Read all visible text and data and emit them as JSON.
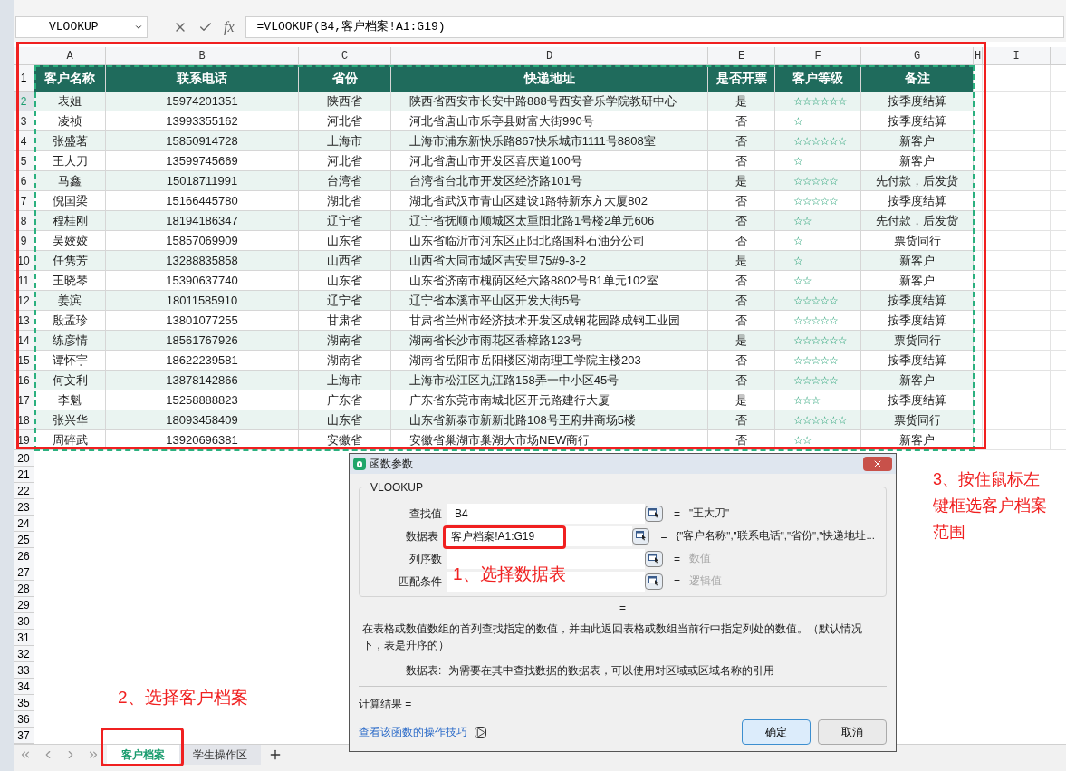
{
  "name_box": {
    "value": "VLOOKUP"
  },
  "formula_bar": {
    "fx": "fx",
    "formula": "=VLOOKUP(B4,客户档案!A1:G19)"
  },
  "column_letters": [
    "A",
    "B",
    "C",
    "D",
    "E",
    "F",
    "G",
    "H",
    "I"
  ],
  "table": {
    "header_row_number": "1",
    "columns": [
      "客户名称",
      "联系电话",
      "省份",
      "快递地址",
      "是否开票",
      "客户等级",
      "备注"
    ],
    "rows": [
      {
        "row_number": "2",
        "selected": true,
        "name": "表姐",
        "phone": "15974201351",
        "province": "陕西省",
        "address": "陕西省西安市长安中路888号西安音乐学院教研中心",
        "invoice": "是",
        "grade": "☆☆☆☆☆☆",
        "note": "按季度结算"
      },
      {
        "row_number": "3",
        "selected": false,
        "name": "凌祯",
        "phone": "13993355162",
        "province": "河北省",
        "address": "河北省唐山市乐亭县财富大街990号",
        "invoice": "否",
        "grade": "☆",
        "note": "按季度结算"
      },
      {
        "row_number": "4",
        "selected": false,
        "name": "张盛茗",
        "phone": "15850914728",
        "province": "上海市",
        "address": "上海市浦东新快乐路867快乐城市1111号8808室",
        "invoice": "否",
        "grade": "☆☆☆☆☆☆",
        "note": "新客户"
      },
      {
        "row_number": "5",
        "selected": false,
        "name": "王大刀",
        "phone": "13599745669",
        "province": "河北省",
        "address": "河北省唐山市开发区喜庆道100号",
        "invoice": "否",
        "grade": "☆",
        "note": "新客户"
      },
      {
        "row_number": "6",
        "selected": false,
        "name": "马鑫",
        "phone": "15018711991",
        "province": "台湾省",
        "address": "台湾省台北市开发区经济路101号",
        "invoice": "是",
        "grade": "☆☆☆☆☆",
        "note": "先付款，后发货"
      },
      {
        "row_number": "7",
        "selected": false,
        "name": "倪国梁",
        "phone": "15166445780",
        "province": "湖北省",
        "address": "湖北省武汉市青山区建设1路特新东方大厦802",
        "invoice": "否",
        "grade": "☆☆☆☆☆",
        "note": "按季度结算"
      },
      {
        "row_number": "8",
        "selected": false,
        "name": "程桂刚",
        "phone": "18194186347",
        "province": "辽宁省",
        "address": "辽宁省抚顺市顺城区太重阳北路1号楼2单元606",
        "invoice": "否",
        "grade": "☆☆",
        "note": "先付款，后发货"
      },
      {
        "row_number": "9",
        "selected": false,
        "name": "吴姣姣",
        "phone": "15857069909",
        "province": "山东省",
        "address": "山东省临沂市河东区正阳北路国科石油分公司",
        "invoice": "否",
        "grade": "☆",
        "note": "票货同行"
      },
      {
        "row_number": "10",
        "selected": false,
        "name": "任隽芳",
        "phone": "13288835858",
        "province": "山西省",
        "address": "山西省大同市城区吉安里75#9-3-2",
        "invoice": "是",
        "grade": "☆",
        "note": "新客户"
      },
      {
        "row_number": "11",
        "selected": false,
        "name": "王晓琴",
        "phone": "15390637740",
        "province": "山东省",
        "address": "山东省济南市槐荫区经六路8802号B1单元102室",
        "invoice": "否",
        "grade": "☆☆",
        "note": "新客户"
      },
      {
        "row_number": "12",
        "selected": false,
        "name": "姜滨",
        "phone": "18011585910",
        "province": "辽宁省",
        "address": "辽宁省本溪市平山区开发大街5号",
        "invoice": "否",
        "grade": "☆☆☆☆☆",
        "note": "按季度结算"
      },
      {
        "row_number": "13",
        "selected": false,
        "name": "殷孟珍",
        "phone": "13801077255",
        "province": "甘肃省",
        "address": "甘肃省兰州市经济技术开发区成钢花园路成钢工业园",
        "invoice": "否",
        "grade": "☆☆☆☆☆",
        "note": "按季度结算"
      },
      {
        "row_number": "14",
        "selected": false,
        "name": "练彦情",
        "phone": "18561767926",
        "province": "湖南省",
        "address": "湖南省长沙市雨花区香樟路123号",
        "invoice": "是",
        "grade": "☆☆☆☆☆☆",
        "note": "票货同行"
      },
      {
        "row_number": "15",
        "selected": false,
        "name": "谭怀宇",
        "phone": "18622239581",
        "province": "湖南省",
        "address": "湖南省岳阳市岳阳楼区湖南理工学院主楼203",
        "invoice": "否",
        "grade": "☆☆☆☆☆",
        "note": "按季度结算"
      },
      {
        "row_number": "16",
        "selected": false,
        "name": "何文利",
        "phone": "13878142866",
        "province": "上海市",
        "address": "上海市松江区九江路158弄一中小区45号",
        "invoice": "否",
        "grade": "☆☆☆☆☆",
        "note": "新客户"
      },
      {
        "row_number": "17",
        "selected": false,
        "name": "李魁",
        "phone": "15258888823",
        "province": "广东省",
        "address": "广东省东莞市南城北区开元路建行大厦",
        "invoice": "是",
        "grade": "☆☆☆",
        "note": "按季度结算"
      },
      {
        "row_number": "18",
        "selected": false,
        "name": "张兴华",
        "phone": "18093458409",
        "province": "山东省",
        "address": "山东省新泰市新新北路108号王府井商场5楼",
        "invoice": "否",
        "grade": "☆☆☆☆☆☆",
        "note": "票货同行"
      },
      {
        "row_number": "19",
        "selected": false,
        "name": "周碎武",
        "phone": "13920696381",
        "province": "安徽省",
        "address": "安徽省巢湖市巢湖大市场NEW商行",
        "invoice": "否",
        "grade": "☆☆",
        "note": "新客户"
      }
    ]
  },
  "empty_rows": [
    "20",
    "21",
    "22",
    "23",
    "24",
    "25",
    "26",
    "27",
    "28",
    "29",
    "30",
    "31",
    "32",
    "33",
    "34",
    "35",
    "36",
    "37"
  ],
  "sheet_tabs": [
    {
      "label": "客户档案",
      "selected": true
    },
    {
      "label": "学生操作区",
      "selected": false
    }
  ],
  "dialog": {
    "title": "函数参数",
    "function_name": "VLOOKUP",
    "params": [
      {
        "label": "查找值",
        "value": "B4",
        "eq": "=",
        "result": "\"王大刀\"",
        "kind": "value"
      },
      {
        "label": "数据表",
        "value": "客户档案!A1:G19",
        "eq": "=",
        "result": "{\"客户名称\",\"联系电话\",\"省份\",\"快递地址...",
        "kind": "value"
      },
      {
        "label": "列序数",
        "eq": "=",
        "result": "数值",
        "kind": "hint"
      },
      {
        "label": "匹配条件",
        "eq": "=",
        "result": "逻辑值",
        "kind": "hint"
      }
    ],
    "formula_result": "=",
    "description": "在表格或数值数组的首列查找指定的数值，并由此返回表格或数组当前行中指定列处的数值。（默认情况下，表是升序的）",
    "arg_name": "数据表:",
    "arg_description": "为需要在其中查找数据的数据表，可以使用对区域或区域名称的引用",
    "calc_result": "计算结果 =",
    "help_link": "查看该函数的操作技巧",
    "buttons": [
      "确定",
      "取消"
    ]
  },
  "annotations": [
    {
      "text": "1、选择数据表"
    },
    {
      "text": "2、选择客户档案"
    },
    {
      "text": "3、按住鼠标左键框选客户档案范围"
    }
  ]
}
